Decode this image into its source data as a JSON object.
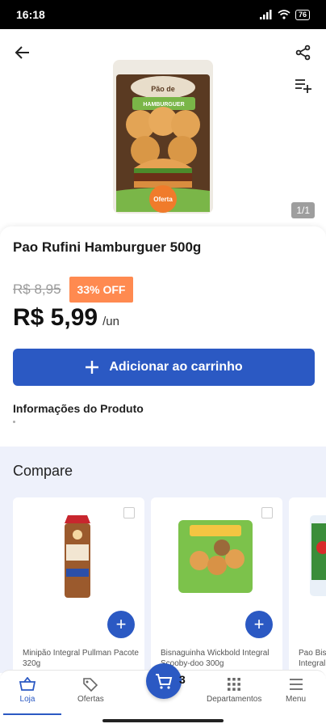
{
  "status_bar": {
    "time": "16:18",
    "battery": "76"
  },
  "header": {
    "back_icon": "arrow-left-icon",
    "share_icon": "share-icon",
    "add_list_icon": "playlist-add-icon"
  },
  "gallery": {
    "image_badge": "Oferta",
    "brand_text": "Pão de",
    "product_text": "HAMBURGUER",
    "page_indicator": "1/1"
  },
  "product": {
    "title": "Pao Rufini Hamburguer 500g",
    "old_price": "R$ 8,95",
    "discount": "33% OFF",
    "price": "R$ 5,99",
    "unit": "/un",
    "add_to_cart_label": "Adicionar ao carrinho",
    "info_title": "Informações do Produto"
  },
  "compare": {
    "title": "Compare",
    "items": [
      {
        "name": "Minipão Integral Pullman Pacote 320g"
      },
      {
        "name": "Bisnaguinha Wickbold Integral Scooby-doo 300g"
      },
      {
        "name": "Pao Bisn Integral"
      }
    ]
  },
  "bottom_nav": {
    "items": [
      {
        "label": "Loja",
        "icon": "basket-icon"
      },
      {
        "label": "Ofertas",
        "icon": "tag-icon"
      },
      {
        "label": "Departamentos",
        "icon": "grid-icon"
      },
      {
        "label": "Menu",
        "icon": "menu-icon"
      }
    ],
    "cart_count": "3"
  },
  "colors": {
    "primary": "#2b59c3",
    "discount": "#ff8a50",
    "compare_bg": "#eef1fb"
  }
}
